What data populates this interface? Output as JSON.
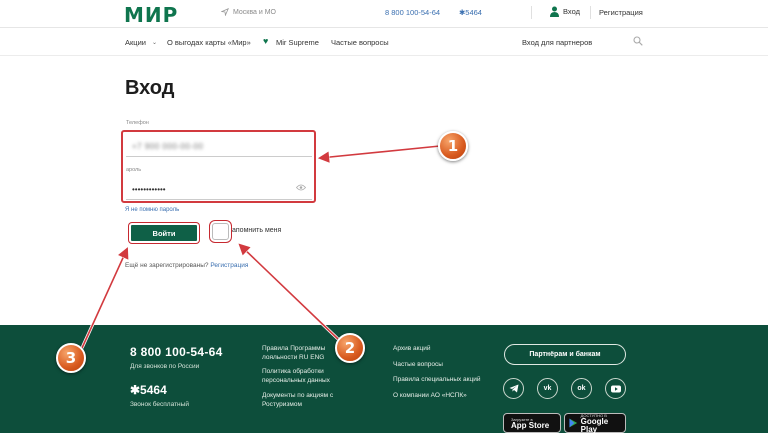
{
  "header": {
    "logo": "МИР",
    "location": "Москва и МО",
    "phone": "8 800 100-54-64",
    "short_number": "✱5464",
    "login": "Вход",
    "register": "Регистрация"
  },
  "nav": {
    "items": [
      "Акции",
      "О выгодах карты «Мир»",
      "Mir Supreme",
      "Частые вопросы"
    ],
    "partner_login": "Вход для партнеров"
  },
  "form": {
    "title": "Вход",
    "phone_label": "Телефон",
    "phone_value": "+7 900 000-00-00",
    "password_label": "ароль",
    "password_value": "••••••••••••",
    "forgot": "Я не помню пароль",
    "submit": "Войти",
    "remember": "апомнить меня",
    "no_account": "Ещё не зарегистрированы?",
    "register_link": "Регистрация"
  },
  "footer": {
    "phone": "8 800 100-54-64",
    "phone_note": "Для звонков по России",
    "short": "✱5464",
    "short_note": "Звонок бесплатный",
    "col2": [
      "Правила Программы лояльности RU ENG",
      "Политика обработки персональных данных",
      "Документы по акциям с Ростуризмом"
    ],
    "col3": [
      "Архив акций",
      "Частые вопросы",
      "Правила специальных акций",
      "О компании АО «НСПК»"
    ],
    "partners_button": "Партнёрам и банкам",
    "social": [
      "telegram-icon",
      "vk-icon",
      "ok-icon",
      "youtube-icon"
    ],
    "app_store_small": "Загрузите в",
    "app_store": "App Store",
    "google_play_small": "ДОСТУПНО В",
    "google_play": "Google Play"
  },
  "annotations": [
    "1",
    "2",
    "3"
  ],
  "colors": {
    "brand": "#0f754e",
    "footer": "#0d4e3b",
    "highlight": "#d23a3f",
    "badge": "#d85a1f"
  }
}
